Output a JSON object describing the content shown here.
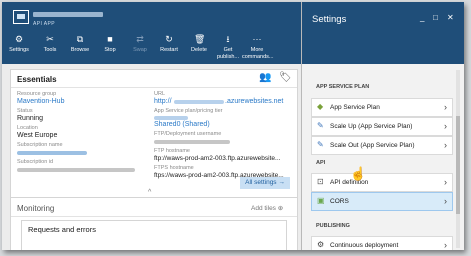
{
  "app": {
    "type": "API APP"
  },
  "toolbar": [
    {
      "icon": "gear-icon",
      "glyph": "⚙",
      "label": "Settings",
      "disabled": false
    },
    {
      "icon": "wrench-icon",
      "glyph": "✂",
      "label": "Tools",
      "disabled": false
    },
    {
      "icon": "external-link-icon",
      "glyph": "⧉",
      "label": "Browse",
      "disabled": false
    },
    {
      "icon": "stop-icon",
      "glyph": "■",
      "label": "Stop",
      "disabled": false
    },
    {
      "icon": "swap-icon",
      "glyph": "⇄",
      "label": "Swap",
      "disabled": true
    },
    {
      "icon": "restart-icon",
      "glyph": "↻",
      "label": "Restart",
      "disabled": false
    },
    {
      "icon": "trash-icon",
      "glyph": "🗑",
      "label": "Delete",
      "disabled": false
    },
    {
      "icon": "download-icon",
      "glyph": "⭳",
      "label": "Get publish...",
      "disabled": false
    },
    {
      "icon": "more-icon",
      "glyph": "···",
      "label": "More commands...",
      "disabled": false
    }
  ],
  "essentials": {
    "title": "Essentials",
    "toggle": "^",
    "resource_group": {
      "label": "Resource group",
      "value": "Mavention-Hub"
    },
    "status": {
      "label": "Status",
      "value": "Running"
    },
    "location": {
      "label": "Location",
      "value": "West Europe"
    },
    "subscription_name": {
      "label": "Subscription name"
    },
    "subscription_id": {
      "label": "Subscription id"
    },
    "url": {
      "label": "URL",
      "prefix": "http://",
      "suffix": ".azurewebsites.net"
    },
    "plan": {
      "label": "App Service plan/pricing tier",
      "value": "Shared0 (Shared)"
    },
    "ftp_user": {
      "label": "FTP/Deployment username"
    },
    "ftp_host": {
      "label": "FTP hostname",
      "value": "ftp://waws-prod-am2-003.ftp.azurewebsite..."
    },
    "ftps_host": {
      "label": "FTPS hostname",
      "value": "ftps://waws-prod-am2-003.ftp.azurewebsite..."
    },
    "all_settings": "All settings →"
  },
  "monitoring": {
    "title": "Monitoring",
    "add_tiles": "Add tiles ⊕",
    "tile_title": "Requests and errors"
  },
  "settings": {
    "title": "Settings",
    "window_controls": {
      "minimize": "_",
      "maximize": "□",
      "close": "✕"
    },
    "sections": [
      {
        "title": "APP SERVICE PLAN",
        "items": [
          {
            "label": "App Service Plan",
            "icon": "service-plan-icon",
            "glyph": "◆",
            "color": "#7aa13a",
            "selected": false
          },
          {
            "label": "Scale Up (App Service Plan)",
            "icon": "scale-up-icon",
            "glyph": "✎",
            "color": "#3b73b9",
            "selected": false
          },
          {
            "label": "Scale Out (App Service Plan)",
            "icon": "scale-out-icon",
            "glyph": "✎",
            "color": "#3b73b9",
            "selected": false
          }
        ]
      },
      {
        "title": "API",
        "items": [
          {
            "label": "API definition",
            "icon": "api-definition-icon",
            "glyph": "⊡",
            "color": "#555555",
            "selected": false
          },
          {
            "label": "CORS",
            "icon": "cors-icon",
            "glyph": "▣",
            "color": "#6aa84f",
            "selected": true
          }
        ]
      },
      {
        "title": "PUBLISHING",
        "items": [
          {
            "label": "Continuous deployment",
            "icon": "deployment-icon",
            "glyph": "⚙",
            "color": "#444444",
            "selected": false
          }
        ]
      }
    ],
    "chevron": "›"
  }
}
